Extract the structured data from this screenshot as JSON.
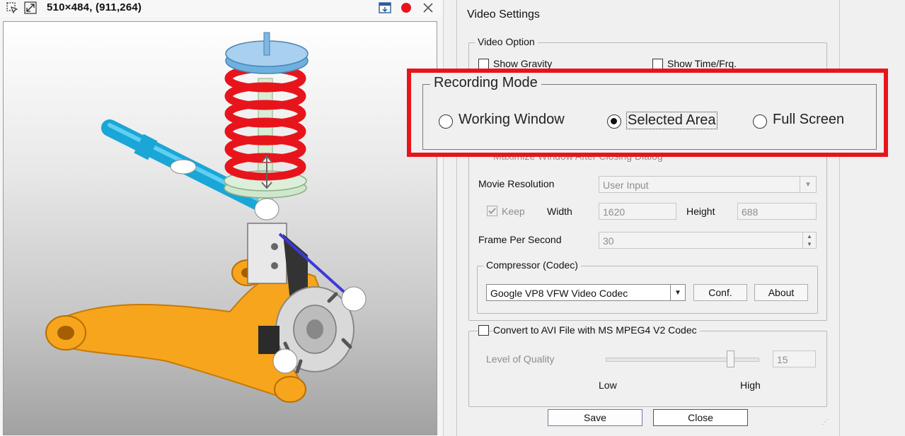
{
  "capture_window": {
    "size_label": "510×484, (911,264)",
    "toolbar_icons": [
      "select-region-icon",
      "resize-icon",
      "window-icon",
      "record-icon",
      "close-icon"
    ],
    "record_color": "#e8141c"
  },
  "dialog": {
    "title": "Video Settings",
    "video_option": {
      "title": "Video Option",
      "show_gravity": "Show Gravity",
      "show_time": "Show Time/Frq.",
      "maximize": "Maximize Window After Closing Dialog"
    },
    "recording_mode": {
      "title": "Recording Mode",
      "options": [
        "Working Window",
        "Selected Area",
        "Full Screen"
      ],
      "selected": "Selected Area"
    },
    "movie_resolution": {
      "label": "Movie Resolution",
      "value": "User Input",
      "keep_label": "Keep",
      "width_label": "Width",
      "width_value": "1620",
      "height_label": "Height",
      "height_value": "688"
    },
    "fps": {
      "label": "Frame Per Second",
      "value": "30"
    },
    "compressor": {
      "title": "Compressor (Codec)",
      "value": "Google VP8 VFW Video Codec",
      "conf_label": "Conf.",
      "about_label": "About"
    },
    "convert": {
      "label": "Convert to AVI File with MS MPEG4 V2 Codec",
      "quality_label": "Level of Quality",
      "quality_value": "15",
      "low_label": "Low",
      "high_label": "High",
      "slider_fraction": 0.82
    },
    "save_label": "Save",
    "close_label": "Close"
  },
  "colors": {
    "highlight": "#e8141c",
    "save_border": "#8a6aa8"
  }
}
